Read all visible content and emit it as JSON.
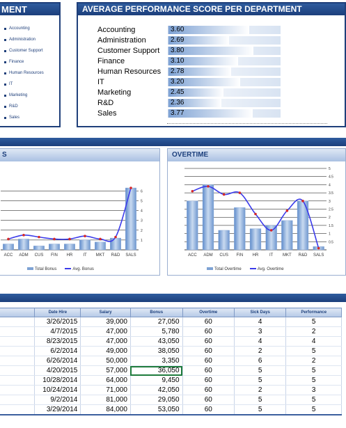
{
  "dept_panel": {
    "title": "MENT",
    "items": [
      "Accounting",
      "Administration",
      "Customer Support",
      "Finance",
      "Human Resources",
      "IT",
      "Marketing",
      "R&D",
      "Sales"
    ]
  },
  "avg_panel": {
    "title": "AVERAGE PERFORMANCE SCORE PER DEPARTMENT",
    "rows": [
      {
        "name": "Accounting",
        "value": "3.60"
      },
      {
        "name": "Administration",
        "value": "2.69"
      },
      {
        "name": "Customer Support",
        "value": "3.80"
      },
      {
        "name": "Finance",
        "value": "3.10"
      },
      {
        "name": "Human Resources",
        "value": "2.78"
      },
      {
        "name": "IT",
        "value": "3.20"
      },
      {
        "name": "Marketing",
        "value": "2.45"
      },
      {
        "name": "R&D",
        "value": "2.36"
      },
      {
        "name": "Sales",
        "value": "3.77"
      }
    ],
    "max": 5
  },
  "bonus_chart": {
    "title": "S",
    "legend_bar": "Total Bonus",
    "legend_line": "Avg. Bonus",
    "axis_unit": "x 10000"
  },
  "ot_chart": {
    "title": "OVERTIME",
    "legend_bar": "Total Overtime",
    "legend_line": "Avg. Overtime",
    "axis_unit": "x 10000"
  },
  "chart_data": [
    {
      "type": "bar",
      "categories": [
        "ACC",
        "ADM",
        "CUS",
        "FIN",
        "HR",
        "IT",
        "MKT",
        "R&D",
        "SALS"
      ],
      "series": [
        {
          "name": "Total Bonus",
          "kind": "bar",
          "values": [
            0.6,
            1.1,
            0.4,
            0.6,
            0.6,
            1.0,
            0.8,
            1.2,
            6.3
          ]
        },
        {
          "name": "Avg. Bonus",
          "kind": "line",
          "values": [
            1.1,
            1.5,
            1.3,
            1.1,
            1.1,
            1.4,
            1.1,
            1.3,
            6.3
          ]
        }
      ],
      "ylim": [
        0,
        8
      ],
      "yticks": [
        1,
        2,
        3,
        4,
        5,
        6
      ]
    },
    {
      "type": "bar",
      "categories": [
        "ACC",
        "ADM",
        "CUS",
        "FIN",
        "HR",
        "IT",
        "MKT",
        "R&D",
        "SALS"
      ],
      "series": [
        {
          "name": "Total Overtime",
          "kind": "bar",
          "values": [
            3.0,
            4.0,
            1.2,
            2.6,
            1.3,
            1.5,
            1.8,
            3.0,
            0.2
          ]
        },
        {
          "name": "Avg. Overtime",
          "kind": "line",
          "values": [
            3.6,
            3.9,
            3.4,
            3.5,
            2.2,
            1.2,
            2.4,
            3.0,
            0.1
          ]
        }
      ],
      "ylim": [
        0,
        5
      ],
      "yticks": [
        0.5,
        1,
        1.5,
        2,
        2.5,
        3,
        3.5,
        4,
        4.5,
        5
      ]
    }
  ],
  "table": {
    "headers": [
      "",
      "Date Hire",
      "Salary",
      "Bonus",
      "Overtime",
      "Sick Days",
      "Performance"
    ],
    "rows": [
      [
        "3/26/2015",
        "39,000",
        "27,050",
        "60",
        "4",
        "5"
      ],
      [
        "4/7/2015",
        "47,000",
        "5,780",
        "60",
        "3",
        "2"
      ],
      [
        "8/23/2015",
        "47,000",
        "43,050",
        "60",
        "4",
        "4"
      ],
      [
        "6/2/2014",
        "49,000",
        "38,050",
        "60",
        "2",
        "5"
      ],
      [
        "6/26/2014",
        "50,000",
        "3,350",
        "60",
        "6",
        "2"
      ],
      [
        "4/20/2015",
        "57,000",
        "36,050",
        "60",
        "5",
        "5"
      ],
      [
        "10/28/2014",
        "64,000",
        "9,450",
        "60",
        "5",
        "5"
      ],
      [
        "10/24/2014",
        "71,000",
        "42,050",
        "60",
        "2",
        "3"
      ],
      [
        "9/2/2014",
        "81,000",
        "29,050",
        "60",
        "5",
        "5"
      ],
      [
        "3/29/2014",
        "84,000",
        "53,050",
        "60",
        "5",
        "5"
      ]
    ],
    "selected_cell": {
      "row": 5,
      "col": 2
    }
  }
}
